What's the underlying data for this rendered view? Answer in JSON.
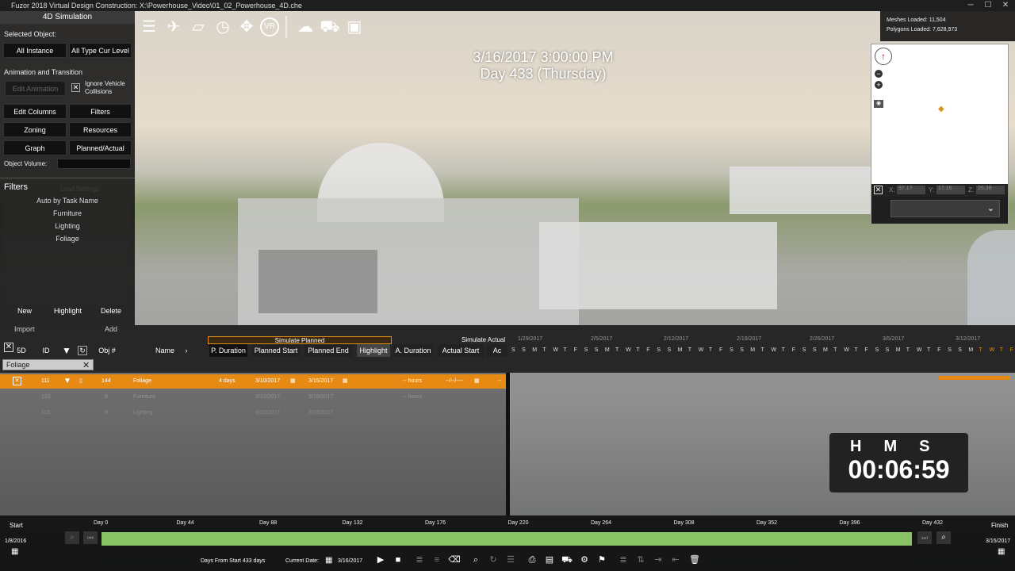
{
  "window": {
    "title": "Fuzor 2018 Virtual Design Construction: X:\\Powerhouse_Video\\01_02_Powerhouse_4D.che",
    "minimize_glyph": "─",
    "maximize_glyph": "☐",
    "close_glyph": "✕"
  },
  "left_panel": {
    "title": "4D Simulation",
    "selected_object_label": "Selected Object:",
    "all_instance": "All Instance",
    "all_type_cur_level": "All Type Cur Level",
    "animation_label": "Animation and Transition",
    "edit_animation": "Edit Animation",
    "ignore_vehicle": "Ignore Vehicle Collisions",
    "edit_columns": "Edit Columns",
    "filters_btn": "Filters",
    "zoning": "Zoning",
    "resources": "Resources",
    "graph": "Graph",
    "planned_actual": "Planned/Actual",
    "object_volume_label": "Object Volume:",
    "object_volume_value": "",
    "filters_title": "Filters",
    "filters_faded": "Load     Settings",
    "filter_items": [
      "Auto by Task Name",
      "Furniture",
      "Lighting",
      "Foliage"
    ],
    "new": "New",
    "highlight": "Highlight",
    "delete": "Delete",
    "import": "Import",
    "add": "Add"
  },
  "toolbar": {
    "icons": [
      "list-icon",
      "drone-icon",
      "folder-icon",
      "clock-icon",
      "move-icon",
      "vr-icon",
      "cloud-icon",
      "vehicle-icon",
      "camera-icon"
    ],
    "vr_text": "VR"
  },
  "stats": {
    "meshes": "Meshes Loaded: 11,504",
    "polygons": "Polygons Loaded: 7,628,973"
  },
  "overlay": {
    "datetime": "3/16/2017 3:00:00 PM",
    "day": "Day 433 (Thursday)"
  },
  "minimap": {
    "x_label": "X:",
    "x_value": "37.17",
    "y_label": "Y:",
    "y_value": "17.16",
    "z_label": "Z:",
    "z_value": "26.38",
    "compass_glyph": "↑",
    "zoom_out_glyph": "−",
    "zoom_in_glyph": "+",
    "view_glyph": "◉",
    "dropdown_glyph": "⌄",
    "checkbox_glyph": "✕",
    "marker_glyph": "◆"
  },
  "timeline_header": {
    "simulate_planned": "Simulate Planned",
    "simulate_actual": "Simulate Actual",
    "col_5d": "5D",
    "col_id": "ID",
    "col_obj": "Obj #",
    "col_name": "Name",
    "chevron_glyph": "›",
    "p_duration": "P. Duration",
    "planned_start": "Planned Start",
    "planned_end": "Planned End",
    "highlight": "Highlight",
    "a_duration": "A. Duration",
    "actual_start": "Actual Start",
    "actual_end_partial": "Ac",
    "filter_value": "Foliage",
    "filter_clear_glyph": "✕",
    "dates": [
      "1/29/2017",
      "2/5/2017",
      "2/12/2017",
      "2/19/2017",
      "2/26/2017",
      "3/5/2017",
      "3/12/2017"
    ],
    "weekday_letters": [
      "S",
      "S",
      "M",
      "T",
      "W",
      "T",
      "F",
      "S",
      "S",
      "M",
      "T",
      "W",
      "T",
      "F",
      "S",
      "S",
      "M",
      "T",
      "W",
      "T",
      "F",
      "S",
      "S",
      "M",
      "T",
      "W",
      "T",
      "F",
      "S",
      "S",
      "M",
      "T",
      "W",
      "T",
      "F",
      "S",
      "S",
      "M",
      "T",
      "W",
      "T",
      "F",
      "S",
      "S",
      "M",
      "T",
      "W",
      "T",
      "F"
    ]
  },
  "grid": {
    "rows": [
      {
        "id": "111",
        "obj": "144",
        "name": "Foliage",
        "duration": "4 days",
        "start": "3/10/2017",
        "end": "3/15/2017",
        "a_duration": "-- hours",
        "a_start": "--/--/----",
        "a_end": "--"
      },
      {
        "id": "123",
        "obj": "9",
        "name": "Furniture",
        "duration": "",
        "start": "3/10/2017",
        "end": "3/15/2017",
        "a_duration": "-- hours",
        "a_start": "",
        "a_end": ""
      },
      {
        "id": "115",
        "obj": "9",
        "name": "Lighting",
        "duration": "",
        "start": "3/10/2017",
        "end": "3/15/2017",
        "a_duration": "",
        "a_start": "",
        "a_end": ""
      }
    ]
  },
  "clock": {
    "h": "H",
    "m": "M",
    "s": "S",
    "time": "00:06:59"
  },
  "bottom": {
    "start_label": "Start",
    "start_date": "1/8/2016",
    "finish_label": "Finish",
    "finish_date": "3/15/2017",
    "day_labels": [
      "Day 0",
      "Day 44",
      "Day 88",
      "Day 132",
      "Day 176",
      "Day 220",
      "Day 264",
      "Day 308",
      "Day 352",
      "Day 396",
      "Day 432"
    ],
    "days_from_start": "Days From Start 433 days",
    "current_date_label": "Current Date:",
    "current_date": "3/16/2017",
    "progress": 1.0
  }
}
